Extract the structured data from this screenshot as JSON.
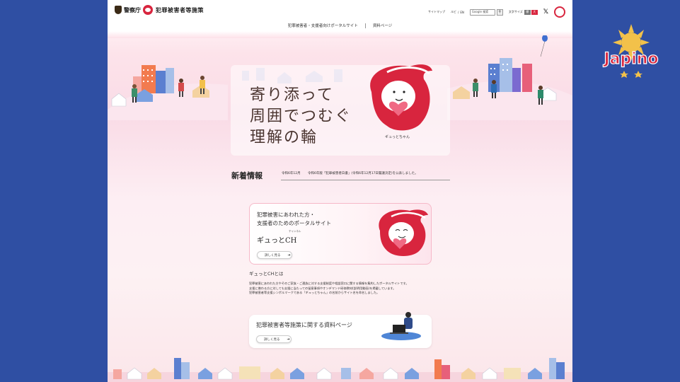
{
  "header": {
    "npa_name": "警察庁",
    "policy_title": "犯罪被害者等施策",
    "links": [
      "サイトマップ",
      "ルビ",
      "EN"
    ],
    "search_placeholder": "Google 検索",
    "text_size_label": "文字サイズ",
    "text_size_buttons": [
      "標",
      "大"
    ],
    "accent_color": "#d8253e"
  },
  "nav": {
    "items": [
      "犯罪被害者・支援者向けポータルサイト",
      "資料ページ"
    ]
  },
  "hero": {
    "title_lines": [
      "寄り添って",
      "周囲でつむぐ",
      "理解の輪"
    ],
    "mascot_caption": "ギュっとちゃん"
  },
  "news": {
    "heading": "新着情報",
    "items": [
      {
        "date": "令和6年12月",
        "text": "令和6年版「犯罪被害者白書」(令和6年12月17日閣議決定)を公表しました。"
      }
    ]
  },
  "card1": {
    "line1": "犯罪被害にあわれた方・",
    "line2": "支援者のためのポータルサイト",
    "ruby": "チャンネル",
    "logo": "ギュっとCH",
    "button": "詳しく見る"
  },
  "about": {
    "heading": "ギュっとCHとは",
    "lines": [
      "犯罪被害にあわれた方やそのご家族・ご遺族に対する支援制度や相談窓口に関する情報を集約したポータルサイトです。",
      "支援に携わる方に対しても支援に当たっての留意事項やオンデマンド研修教材(説明用動画)を掲載しています。",
      "犯罪被害者等支援シンボルマークである「ギュっとちゃん」の名前からサイト名を命名しました。"
    ]
  },
  "card2": {
    "title": "犯罪被害者等施策に関する資料ページ",
    "button": "詳しく見る"
  },
  "watermark": {
    "text": "Japino"
  }
}
